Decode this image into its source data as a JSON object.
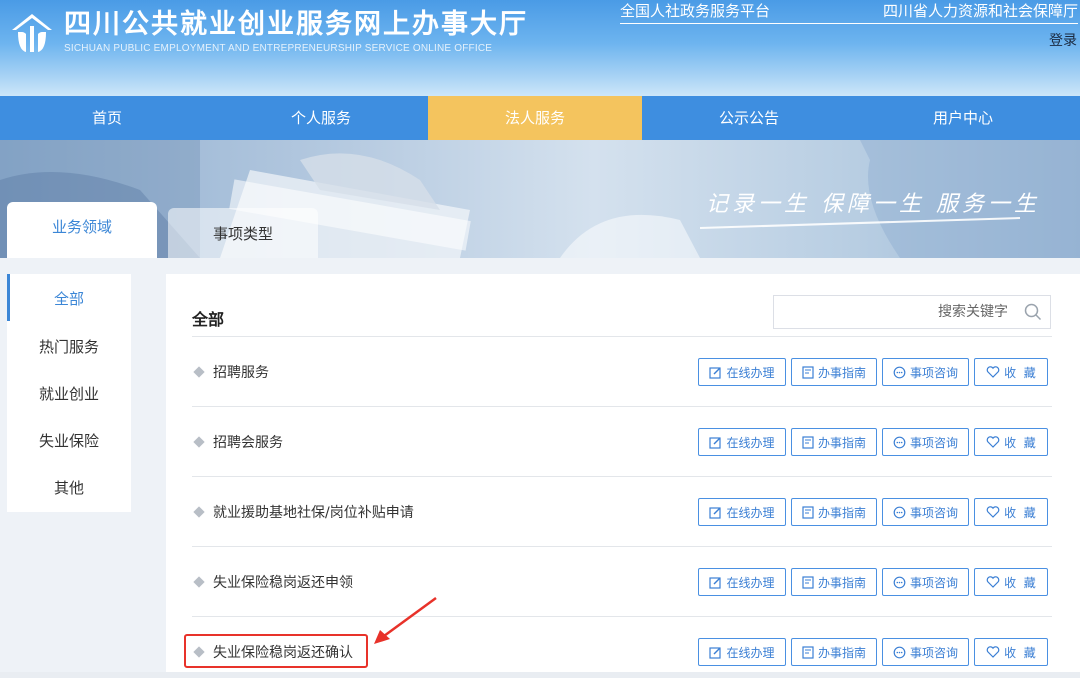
{
  "header": {
    "title": "四川公共就业创业服务网上办事大厅",
    "subtitle": "SICHUAN PUBLIC EMPLOYMENT AND ENTREPRENEURSHIP SERVICE ONLINE OFFICE",
    "top_links": [
      "全国人社政务服务平台",
      "四川省人力资源和社会保障厅"
    ],
    "login": "登录"
  },
  "nav": {
    "items": [
      "首页",
      "个人服务",
      "法人服务",
      "公示公告",
      "用户中心"
    ],
    "active": "法人服务"
  },
  "banner": {
    "slogan": "记录一生  保障一生  服务一生",
    "tabs": [
      "业务领域",
      "事项类型"
    ]
  },
  "sidebar": {
    "items": [
      "全部",
      "热门服务",
      "就业创业",
      "失业保险",
      "其他"
    ],
    "active": "全部"
  },
  "main": {
    "title": "全部",
    "search": {
      "placeholder": "搜索关键字"
    },
    "actions": [
      "在线办理",
      "办事指南",
      "事项咨询",
      "收  藏"
    ],
    "rows": [
      {
        "name": "招聘服务"
      },
      {
        "name": "招聘会服务"
      },
      {
        "name": "就业援助基地社保/岗位补贴申请"
      },
      {
        "name": "失业保险稳岗返还申领"
      },
      {
        "name": "失业保险稳岗返还确认",
        "highlighted": true
      }
    ]
  },
  "colors": {
    "accent": "#3b86d6",
    "nav": "#3e8ee0",
    "nav_active": "#f4c45e",
    "annotation": "#e8322a"
  }
}
